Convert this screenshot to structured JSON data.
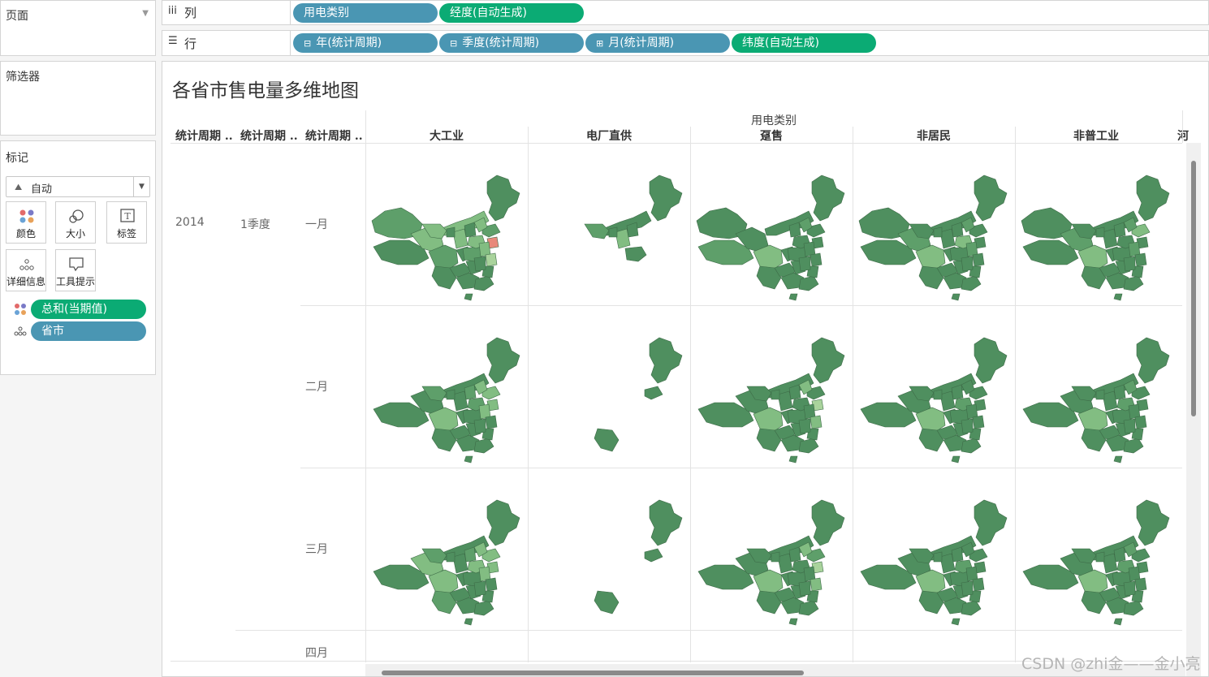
{
  "panels": {
    "pages": "页面",
    "filters": "筛选器",
    "marks": "标记"
  },
  "marks": {
    "type_dropdown": "自动",
    "buttons": {
      "color": "颜色",
      "size": "大小",
      "label": "标签",
      "detail": "详细信息",
      "tooltip": "工具提示"
    },
    "fields": {
      "color_field": "总和(当期值)",
      "detail_field": "省市"
    }
  },
  "shelves": {
    "columns": {
      "label": "列",
      "pills": [
        "用电类别",
        "经度(自动生成)"
      ]
    },
    "rows": {
      "label": "行",
      "pills": [
        "年(统计周期)",
        "季度(统计周期)",
        "月(统计周期)",
        "纬度(自动生成)"
      ]
    }
  },
  "view": {
    "title": "各省市售电量多维地图",
    "column_group_header": "用电类别",
    "column_headers": [
      "大工业",
      "电厂直供",
      "趸售",
      "非居民",
      "非普工业",
      "河"
    ],
    "row_header_titles": [
      "统计周期 ..",
      "统计周期 ..",
      "统计周期 .."
    ],
    "year": "2014",
    "quarter": "1季度",
    "months": [
      "一月",
      "二月",
      "三月",
      "四月"
    ]
  },
  "colors": {
    "map_dark": "#4f8f5f",
    "map_mid": "#5e9f6a",
    "map_light": "#82bd82",
    "map_pale": "#a9d39c",
    "highlight": "#e8897a",
    "pill_blue": "#4a96b3",
    "pill_green": "#0bab74"
  },
  "watermark": "CSDN @zhi金——金小亮"
}
